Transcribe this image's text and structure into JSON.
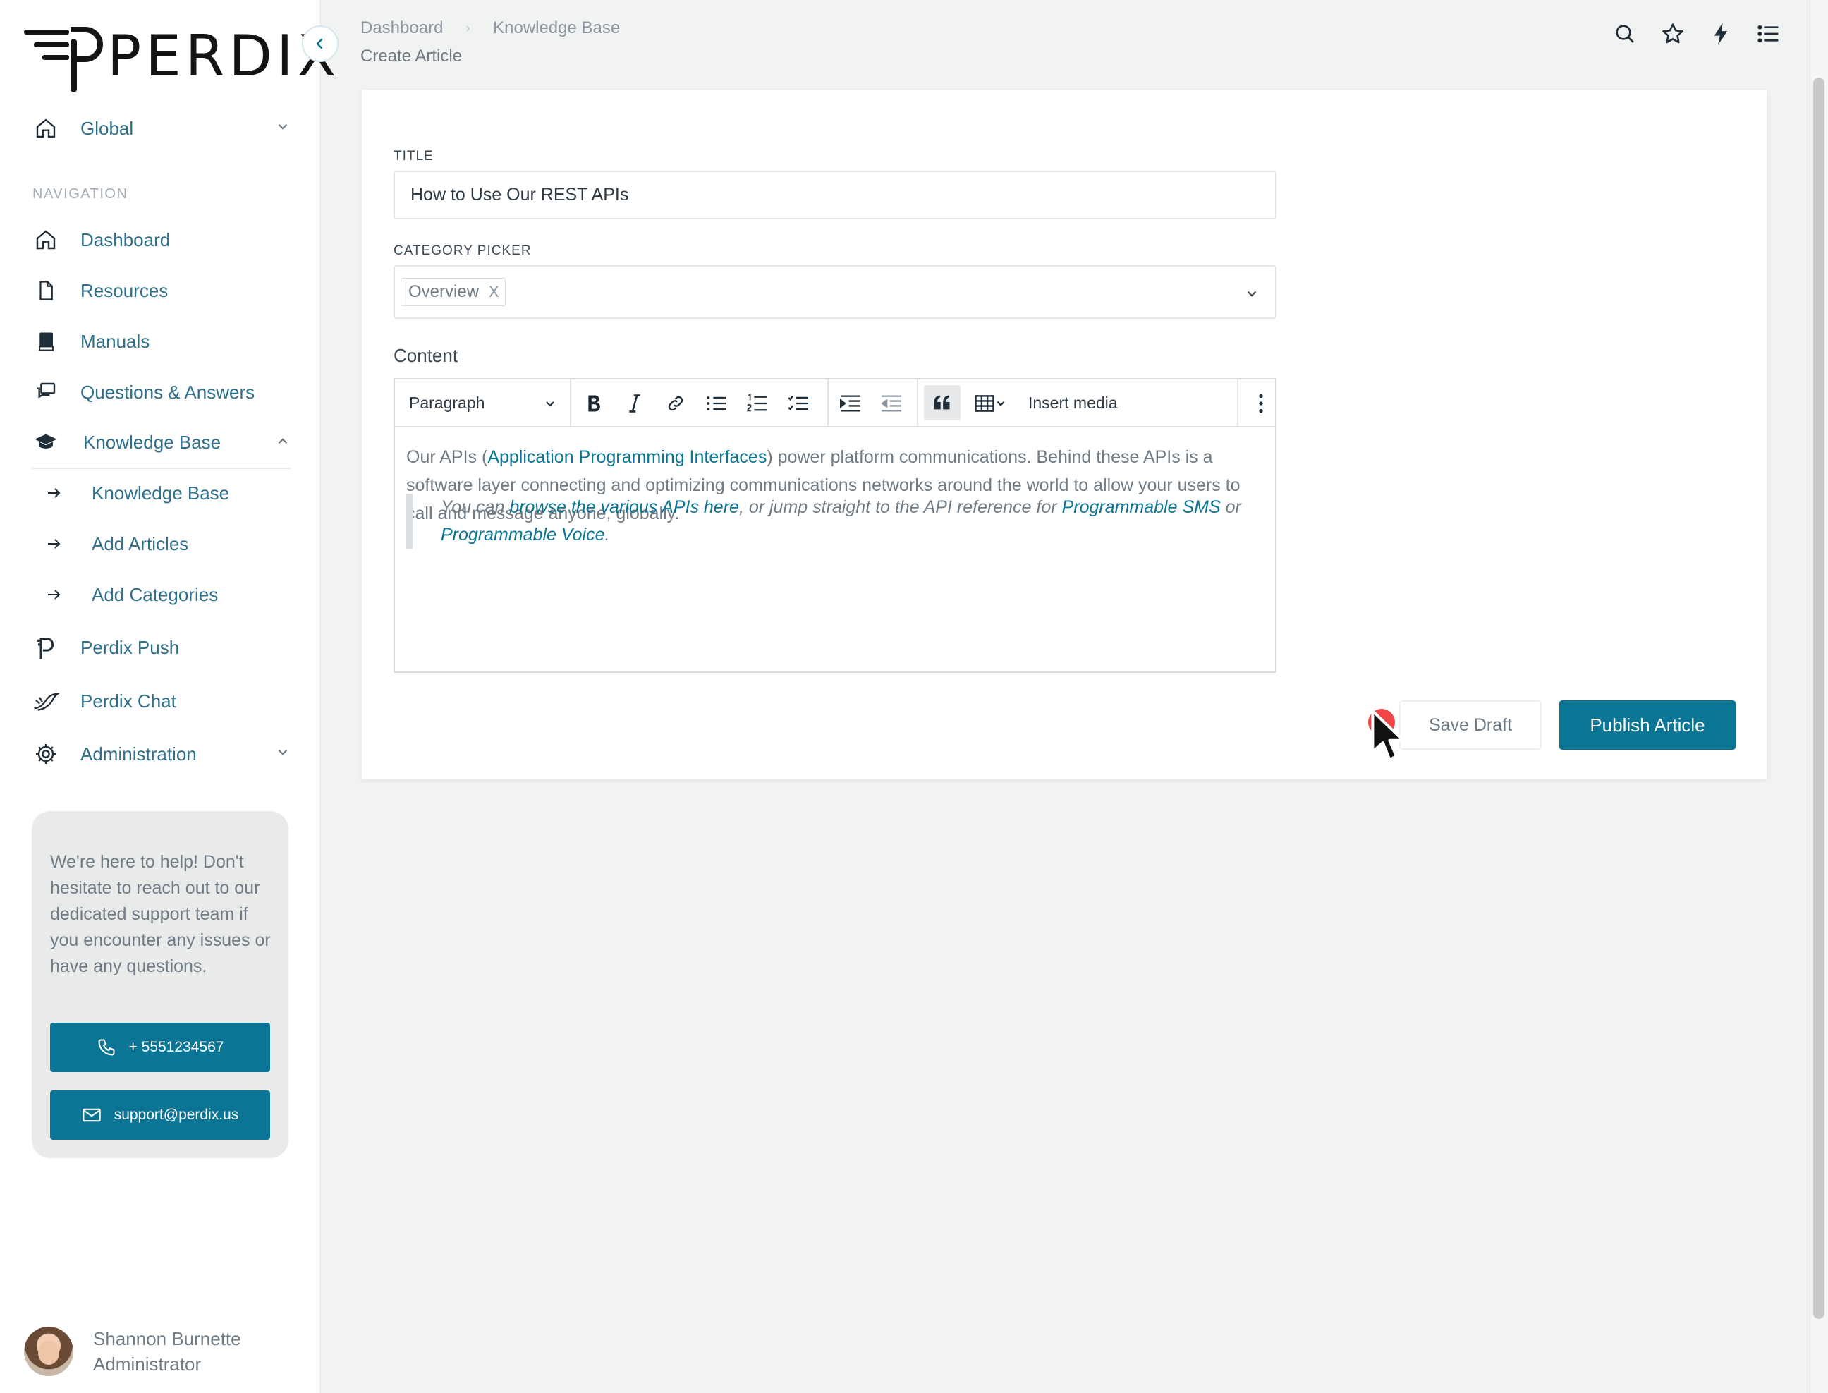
{
  "brand": {
    "logo_text": "PERDIX"
  },
  "sidebar": {
    "workspace": {
      "label": "Global"
    },
    "section_label": "NAVIGATION",
    "items": [
      {
        "label": "Dashboard",
        "icon": "home-icon"
      },
      {
        "label": "Resources",
        "icon": "document-icon"
      },
      {
        "label": "Manuals",
        "icon": "book-icon"
      },
      {
        "label": "Questions & Answers",
        "icon": "chat-icon"
      },
      {
        "label": "Knowledge Base",
        "icon": "graduation-cap-icon",
        "expanded": true
      },
      {
        "label": "Perdix Push",
        "icon": "perdix-push-icon"
      },
      {
        "label": "Perdix Chat",
        "icon": "bird-icon"
      },
      {
        "label": "Administration",
        "icon": "gear-icon"
      }
    ],
    "sub_items": [
      {
        "label": "Knowledge Base"
      },
      {
        "label": "Add Articles"
      },
      {
        "label": "Add Categories"
      }
    ],
    "help": {
      "text": "We're here to help! Don't hesitate to reach out to our dedicated support team if you encounter any issues or have any questions.",
      "phone": "+ 5551234567",
      "email": "support@perdix.us"
    },
    "user": {
      "name": "Shannon Burnette",
      "role": "Administrator"
    }
  },
  "header": {
    "breadcrumb": [
      "Dashboard",
      "Knowledge Base"
    ],
    "page_title": "Create Article"
  },
  "form": {
    "title_label": "TITLE",
    "title_value": "How to Use Our REST APIs",
    "category_label": "CATEGORY PICKER",
    "category_tag": "Overview",
    "category_tag_remove": "X",
    "content_label": "Content",
    "toolbar": {
      "block_format": "Paragraph",
      "insert_media": "Insert media"
    },
    "body": {
      "p_before": "Our APIs (",
      "p_link": "Application Programming Interfaces",
      "p_after": ") power platform communications. Behind these APIs is a software layer connecting and optimizing communications networks around the world to allow your users to call and message anyone, globally.",
      "q_1": "You can ",
      "q_link1": "browse the various APIs here",
      "q_2": ", or jump straight to the API reference for ",
      "q_link2": "Programmable SMS",
      "q_3": " or ",
      "q_link3": "Programmable Voice",
      "q_4": "."
    },
    "save_draft": "Save Draft",
    "publish": "Publish Article"
  },
  "colors": {
    "accent": "#0a7595",
    "link": "#0a7595",
    "cursor_dot": "#ef4747"
  }
}
